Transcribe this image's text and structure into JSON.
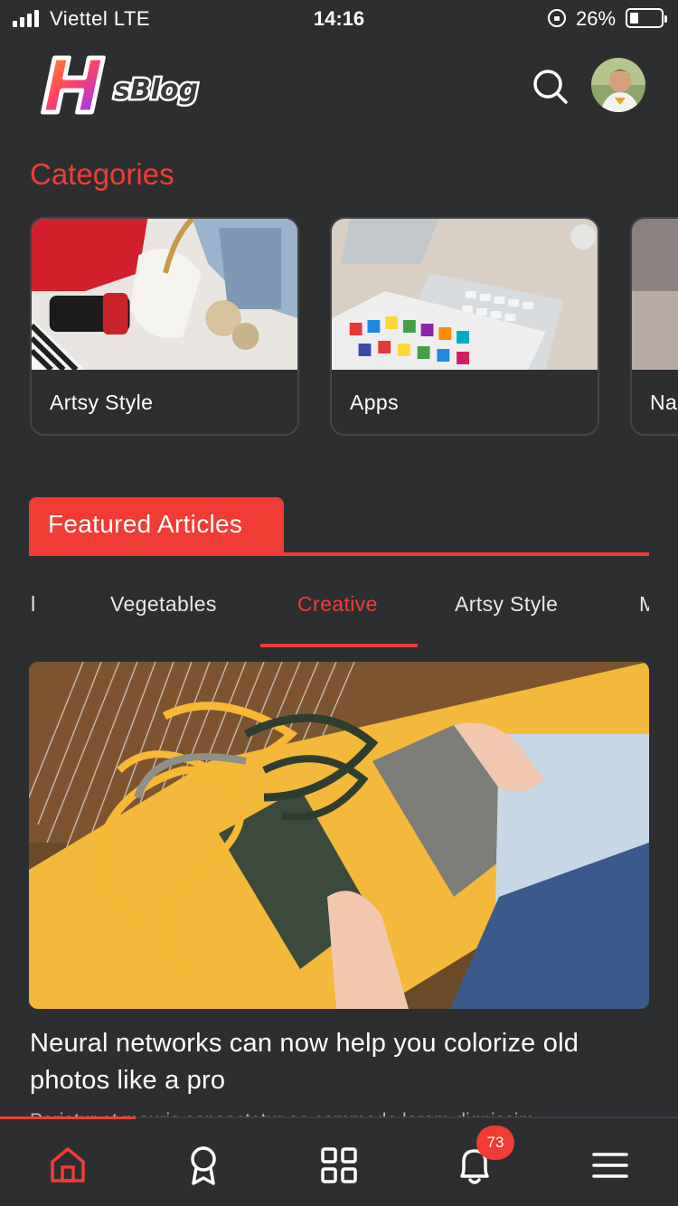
{
  "status_bar": {
    "carrier": "Viettel  LTE",
    "time": "14:16",
    "battery": "26%"
  },
  "header": {
    "logo_text": "HsBlog",
    "search_icon": "search-icon",
    "avatar": "user-avatar"
  },
  "categories": {
    "title": "Categories",
    "items": [
      {
        "label": "Artsy Style"
      },
      {
        "label": "Apps"
      },
      {
        "label": "Na"
      }
    ]
  },
  "featured": {
    "title": "Featured Articles",
    "tabs": [
      {
        "label": "l"
      },
      {
        "label": "Vegetables"
      },
      {
        "label": "Creative"
      },
      {
        "label": "Artsy Style"
      },
      {
        "label": "M"
      }
    ],
    "active_tab": "Creative",
    "article": {
      "title": "Neural networks can now help you colorize old photos like a pro",
      "excerpt": "Pariatur et mauris consectetur ac commodo lorem dignissim"
    }
  },
  "bottom_nav": {
    "items": [
      {
        "icon": "home-icon",
        "active": true
      },
      {
        "icon": "award-icon"
      },
      {
        "icon": "grid-icon"
      },
      {
        "icon": "bell-icon"
      },
      {
        "icon": "menu-icon"
      }
    ],
    "notification_count": "73"
  },
  "colors": {
    "accent": "#f03c34",
    "background": "#2d2e30"
  }
}
